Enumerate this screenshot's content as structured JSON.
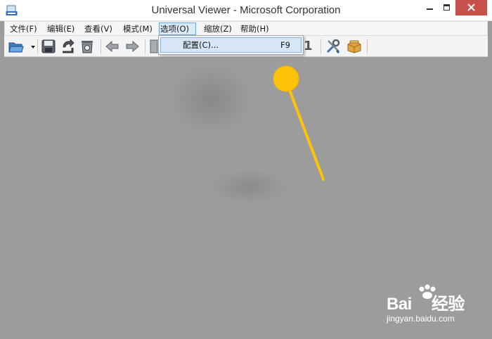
{
  "window": {
    "title": "Universal Viewer - Microsoft Corporation",
    "icons": [
      "app-icon",
      "minimize-icon",
      "maximize-icon",
      "close-icon"
    ],
    "close_color": "#c7504b"
  },
  "menubar": {
    "items": [
      {
        "label": "文件(F)"
      },
      {
        "label": "编辑(E)"
      },
      {
        "label": "查看(V)"
      },
      {
        "label": "模式(M)"
      },
      {
        "label": "选项(O)",
        "active": true
      },
      {
        "label": "缩放(Z)"
      },
      {
        "label": "帮助(H)"
      }
    ]
  },
  "dropdown": {
    "items": [
      {
        "label": "配置(C)...",
        "shortcut": "F9",
        "highlighted": true
      }
    ],
    "highlight_color": "#d7e6f6"
  },
  "toolbar": {
    "icons": [
      "open-folder-icon",
      "save-icon",
      "reload-icon",
      "delete-icon",
      "prev-arrow-icon",
      "next-arrow-icon",
      "page-icon",
      "tools-icon",
      "package-icon"
    ],
    "page_indicator": "1"
  },
  "annotation": {
    "type": "pointer",
    "color": "#fdc407"
  },
  "watermark": {
    "brand_a": "Bai",
    "brand_b": "经验",
    "url": "jingyan.baidu.com"
  }
}
